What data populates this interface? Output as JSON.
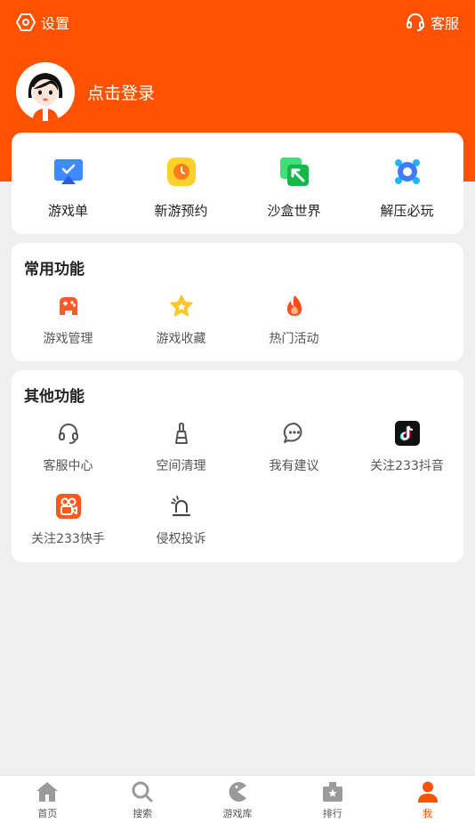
{
  "topbar": {
    "settings_label": "设置",
    "service_label": "客服"
  },
  "profile": {
    "login_label": "点击登录"
  },
  "quick": [
    {
      "label": "游戏单",
      "icon": "game-list-icon"
    },
    {
      "label": "新游预约",
      "icon": "clock-icon"
    },
    {
      "label": "沙盒世界",
      "icon": "sandbox-icon"
    },
    {
      "label": "解压必玩",
      "icon": "gear-flower-icon"
    }
  ],
  "common": {
    "title": "常用功能",
    "items": [
      {
        "label": "游戏管理",
        "icon": "gamepad-icon"
      },
      {
        "label": "游戏收藏",
        "icon": "star-icon"
      },
      {
        "label": "热门活动",
        "icon": "flame-icon"
      }
    ]
  },
  "other": {
    "title": "其他功能",
    "items": [
      {
        "label": "客服中心",
        "icon": "headset-icon"
      },
      {
        "label": "空间清理",
        "icon": "broom-icon"
      },
      {
        "label": "我有建议",
        "icon": "chat-bubble-icon"
      },
      {
        "label": "关注233抖音",
        "icon": "tiktok-icon"
      },
      {
        "label": "关注233快手",
        "icon": "kuaishou-icon"
      },
      {
        "label": "侵权投诉",
        "icon": "alarm-icon"
      }
    ]
  },
  "nav": [
    {
      "label": "首页",
      "icon": "home-icon"
    },
    {
      "label": "搜索",
      "icon": "search-icon"
    },
    {
      "label": "游戏库",
      "icon": "pacman-icon"
    },
    {
      "label": "排行",
      "icon": "ranking-icon"
    },
    {
      "label": "我",
      "icon": "user-icon"
    }
  ],
  "colors": {
    "brand": "#ff5200",
    "background": "#efefef"
  }
}
